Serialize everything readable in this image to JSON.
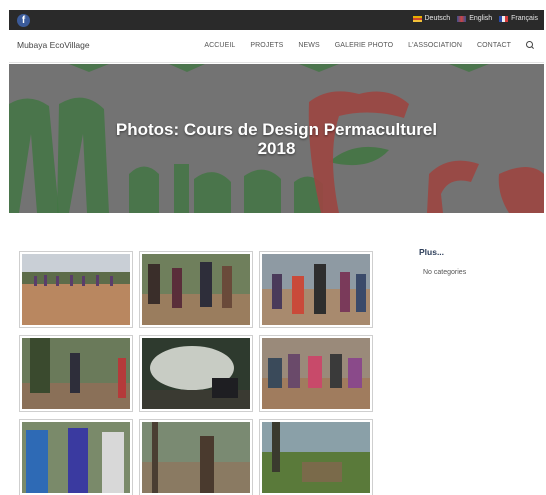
{
  "topbar": {
    "facebook_glyph": "f",
    "languages": [
      {
        "label": "Deutsch",
        "icon": "flag-de-icon"
      },
      {
        "label": "English",
        "icon": "flag-en-icon"
      },
      {
        "label": "Français",
        "icon": "flag-fr-icon"
      }
    ]
  },
  "nav": {
    "brand": "Mubaya EcoVillage",
    "items": [
      "ACCUEIL",
      "PROJETS",
      "NEWS",
      "GALERIE PHOTO",
      "L'ASSOCIATION",
      "CONTACT"
    ],
    "search_icon": "search-icon"
  },
  "hero": {
    "title_line1": "Photos: Cours de Design Permaculturel",
    "title_line2": "2018"
  },
  "sidebar": {
    "title": "Plus...",
    "text": "No categories"
  },
  "colors": {
    "topbar": "#2a2a2a",
    "facebook": "#3b5b9a",
    "hero_overlay": "#6f6f6f",
    "logo_green": "#2c7a2e",
    "logo_red": "#b5302a",
    "sidebar_title": "#2d3e5a"
  }
}
